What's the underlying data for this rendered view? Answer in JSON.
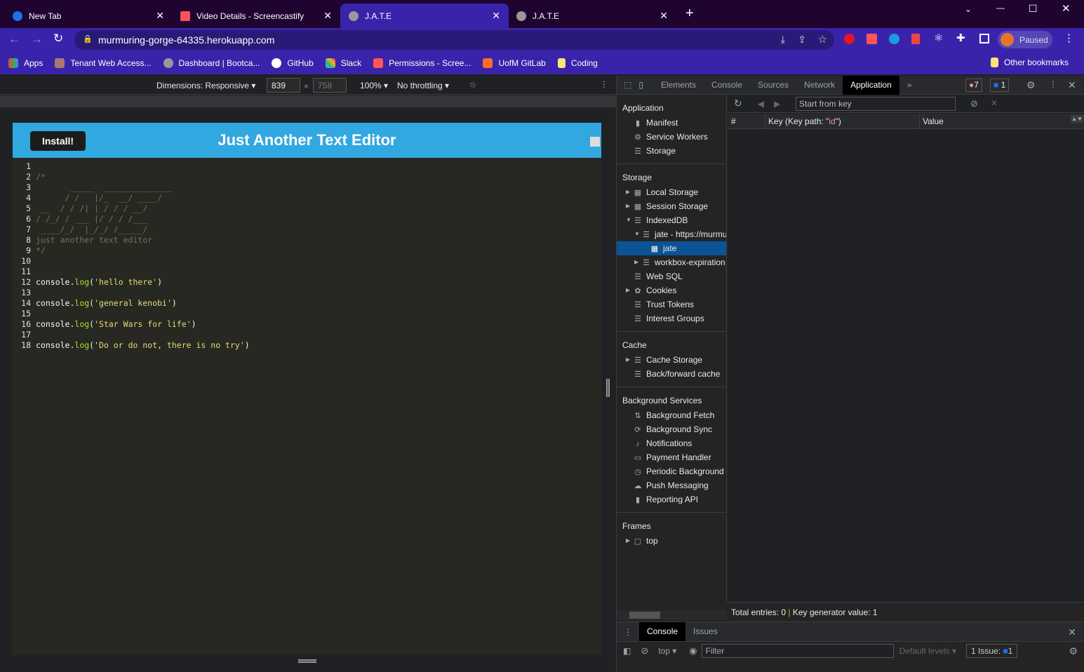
{
  "browser": {
    "tabs": [
      {
        "title": "New Tab",
        "active": false
      },
      {
        "title": "Video Details - Screencastify",
        "active": false
      },
      {
        "title": "J.A.T.E",
        "active": true
      },
      {
        "title": "J.A.T.E",
        "active": false
      }
    ],
    "url": "murmuring-gorge-64335.herokuapp.com",
    "profile": "Paused",
    "bookmarks": [
      "Apps",
      "Tenant Web Access...",
      "Dashboard | Bootca...",
      "GitHub",
      "Slack",
      "Permissions - Scree...",
      "UofM GitLab",
      "Coding"
    ],
    "other_bookmarks": "Other bookmarks"
  },
  "device_toolbar": {
    "dimensions": "Dimensions: Responsive",
    "width": "839",
    "height": "758",
    "zoom": "100%",
    "throttling": "No throttling"
  },
  "app": {
    "install_label": "Install!",
    "title": "Just Another Text Editor",
    "code": [
      [],
      [
        [
          "cm",
          "/*"
        ]
      ],
      [
        [
          "cm",
          "       _____  ______________"
        ]
      ],
      [
        [
          "cm",
          "      / /   |/_  __/ ____/"
        ]
      ],
      [
        [
          "cm",
          " __  / / /| | / / / __/"
        ]
      ],
      [
        [
          "cm",
          "/ /_/ / ___ |/ / / /___"
        ]
      ],
      [
        [
          "cm",
          " ____/_/  |_/_/ /_____/"
        ]
      ],
      [
        [
          "cm",
          "just another text editor"
        ]
      ],
      [
        [
          "cm",
          "*/"
        ]
      ],
      [],
      [],
      [
        [
          "pl",
          "console."
        ],
        [
          "fn",
          "log"
        ],
        [
          "pl",
          "("
        ],
        [
          "st",
          "'hello there'"
        ],
        [
          "pl",
          ")"
        ]
      ],
      [],
      [
        [
          "pl",
          "console."
        ],
        [
          "fn",
          "log"
        ],
        [
          "pl",
          "("
        ],
        [
          "st",
          "'general kenobi'"
        ],
        [
          "pl",
          ")"
        ]
      ],
      [],
      [
        [
          "pl",
          "console."
        ],
        [
          "fn",
          "log"
        ],
        [
          "pl",
          "("
        ],
        [
          "st",
          "'Star Wars for life'"
        ],
        [
          "pl",
          ")"
        ]
      ],
      [],
      [
        [
          "pl",
          "console."
        ],
        [
          "fn",
          "log"
        ],
        [
          "pl",
          "("
        ],
        [
          "st",
          "'Do or do not, there is no try'"
        ],
        [
          "pl",
          ")"
        ]
      ]
    ]
  },
  "devtools": {
    "tabs": [
      "Elements",
      "Console",
      "Sources",
      "Network",
      "Application"
    ],
    "active_tab": "Application",
    "errors": "7",
    "messages": "1",
    "sidebar": [
      {
        "header": "Application",
        "items": [
          {
            "label": "Manifest",
            "icon": "file"
          },
          {
            "label": "Service Workers",
            "icon": "gear"
          },
          {
            "label": "Storage",
            "icon": "db"
          }
        ]
      },
      {
        "header": "Storage",
        "items": [
          {
            "label": "Local Storage",
            "icon": "grid",
            "tri": "▶",
            "lvl": 0
          },
          {
            "label": "Session Storage",
            "icon": "grid",
            "tri": "▶",
            "lvl": 0
          },
          {
            "label": "IndexedDB",
            "icon": "db",
            "tri": "▼",
            "lvl": 0
          },
          {
            "label": "jate - https://murmuring",
            "icon": "db",
            "tri": "▼",
            "lvl": 1
          },
          {
            "label": "jate",
            "icon": "grid",
            "lvl": 2,
            "selected": true
          },
          {
            "label": "workbox-expiration",
            "icon": "db",
            "tri": "▶",
            "lvl": 1
          },
          {
            "label": "Web SQL",
            "icon": "db"
          },
          {
            "label": "Cookies",
            "icon": "cookie",
            "tri": "▶",
            "lvl": 0
          },
          {
            "label": "Trust Tokens",
            "icon": "db"
          },
          {
            "label": "Interest Groups",
            "icon": "db"
          }
        ]
      },
      {
        "header": "Cache",
        "items": [
          {
            "label": "Cache Storage",
            "icon": "db",
            "tri": "▶",
            "lvl": 0
          },
          {
            "label": "Back/forward cache",
            "icon": "db"
          }
        ]
      },
      {
        "header": "Background Services",
        "items": [
          {
            "label": "Background Fetch",
            "icon": "updown"
          },
          {
            "label": "Background Sync",
            "icon": "sync"
          },
          {
            "label": "Notifications",
            "icon": "bell"
          },
          {
            "label": "Payment Handler",
            "icon": "card"
          },
          {
            "label": "Periodic Background",
            "icon": "clock"
          },
          {
            "label": "Push Messaging",
            "icon": "cloud"
          },
          {
            "label": "Reporting API",
            "icon": "file"
          }
        ]
      },
      {
        "header": "Frames",
        "items": [
          {
            "label": "top",
            "icon": "frame",
            "tri": "▶",
            "lvl": 0
          }
        ]
      }
    ],
    "start_from_key_placeholder": "Start from key",
    "columns": {
      "num": "#",
      "key_prefix": "Key (Key path: \"",
      "key_path": "id",
      "key_suffix": "\")",
      "value": "Value"
    },
    "status": {
      "total": "Total entries: 0",
      "keygen": "Key generator value: 1"
    },
    "drawer_tabs": [
      "Console",
      "Issues"
    ],
    "console": {
      "context": "top",
      "filter_placeholder": "Filter",
      "levels": "Default levels",
      "issues": "1 Issue:",
      "issues_count": "1"
    }
  }
}
